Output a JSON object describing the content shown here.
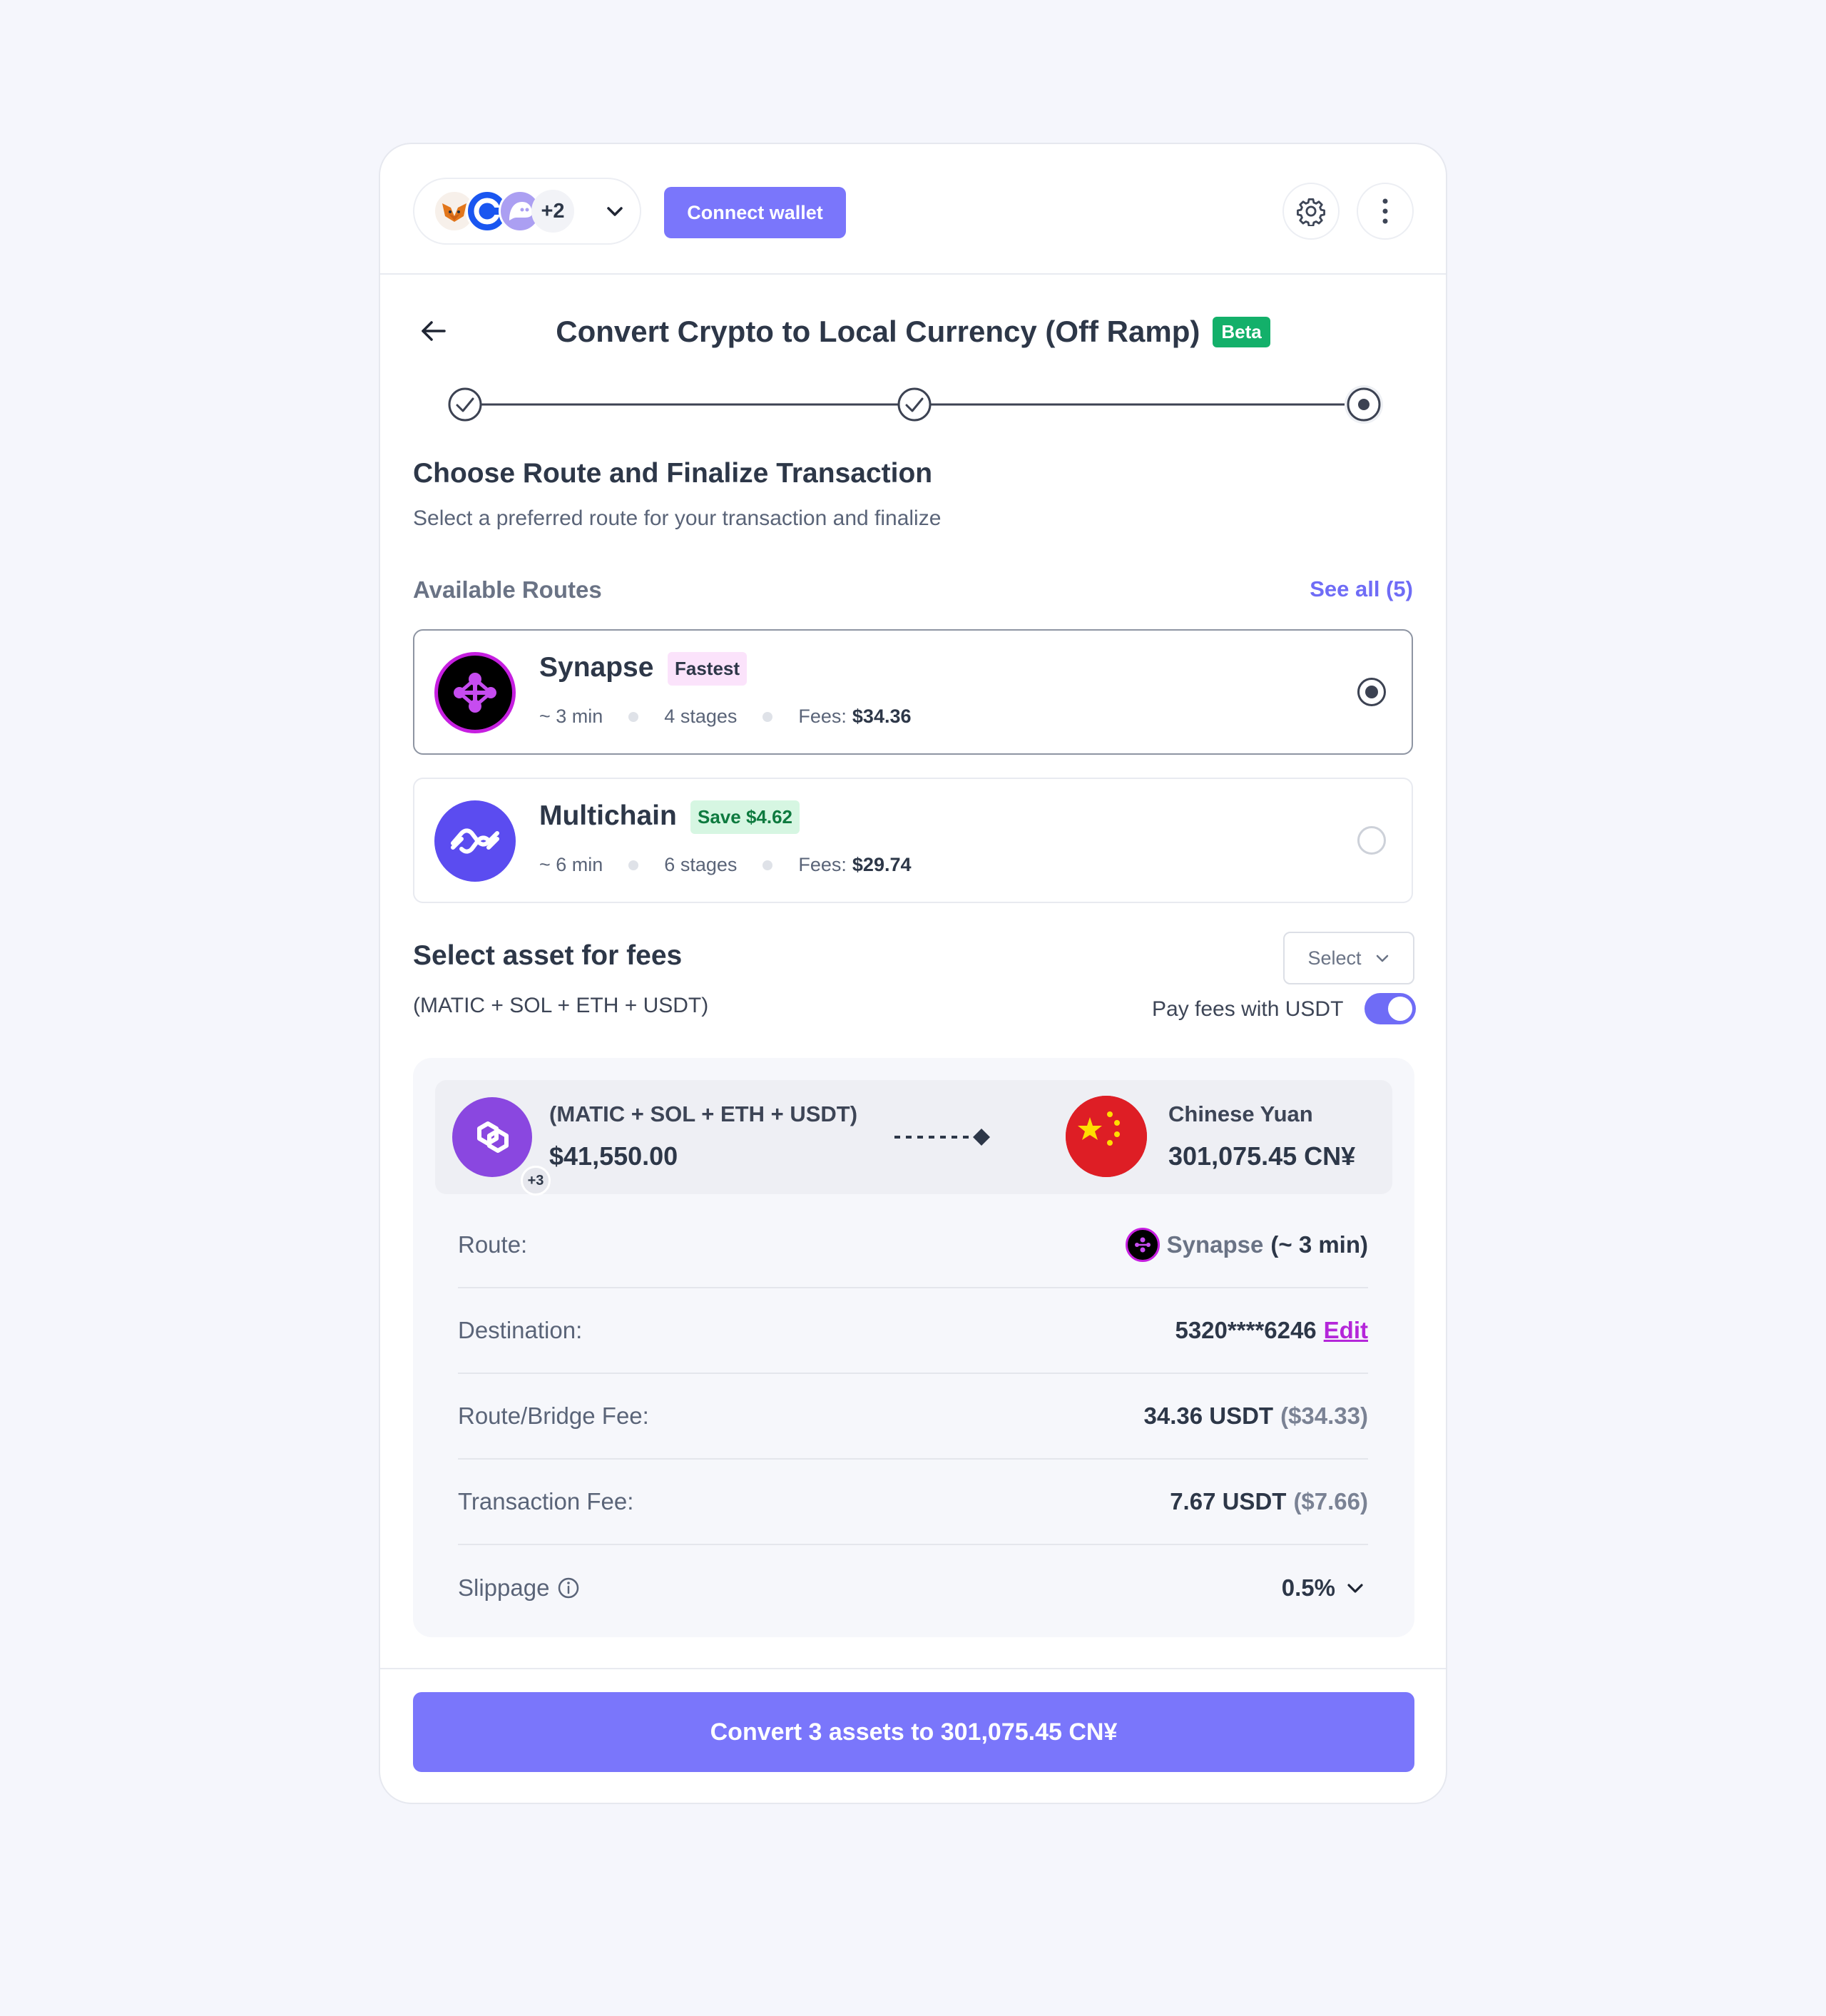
{
  "header": {
    "wallet_more_count": "+2",
    "connect_label": "Connect wallet"
  },
  "page": {
    "title": "Convert Crypto to Local Currency (Off Ramp)",
    "beta_badge": "Beta",
    "steps_total": 3,
    "current_step": 3
  },
  "section": {
    "title": "Choose Route and Finalize Transaction",
    "subtitle": "Select a preferred route for your transaction and finalize"
  },
  "routes": {
    "label": "Available Routes",
    "see_all": "See all (5)",
    "items": [
      {
        "name": "Synapse",
        "tag": "Fastest",
        "time": "~ 3 min",
        "stages": "4 stages",
        "fees_label": "Fees:",
        "fees_value": "$34.36",
        "selected": true
      },
      {
        "name": "Multichain",
        "tag": "Save $4.62",
        "time": "~ 6 min",
        "stages": "6 stages",
        "fees_label": "Fees:",
        "fees_value": "$29.74",
        "selected": false
      }
    ]
  },
  "fees": {
    "title": "Select asset for fees",
    "assets": "(MATIC + SOL + ETH + USDT)",
    "select_placeholder": "Select",
    "pay_label": "Pay fees with USDT",
    "pay_toggle_on": true
  },
  "summary": {
    "from_assets": "(MATIC + SOL + ETH + USDT)",
    "from_amount": "$41,550.00",
    "from_badge": "+3",
    "to_currency": "Chinese Yuan",
    "to_amount": "301,075.45 CN¥",
    "rows": {
      "route_label": "Route:",
      "route_name": "Synapse",
      "route_time": "(~ 3 min)",
      "destination_label": "Destination:",
      "destination_value": "5320****6246",
      "destination_edit": "Edit",
      "bridge_label": "Route/Bridge Fee:",
      "bridge_value": "34.36 USDT",
      "bridge_usd": "($34.33)",
      "tx_label": "Transaction Fee:",
      "tx_value": "7.67 USDT",
      "tx_usd": "($7.66)",
      "slippage_label": "Slippage",
      "slippage_value": "0.5%"
    }
  },
  "cta": {
    "label": "Convert 3 assets to 301,075.45 CN¥"
  },
  "colors": {
    "accent": "#7a76fb",
    "beta": "#13b06a",
    "synapse": "#c61fe0",
    "multichain": "#5b4cf0",
    "edit": "#b426d9"
  }
}
